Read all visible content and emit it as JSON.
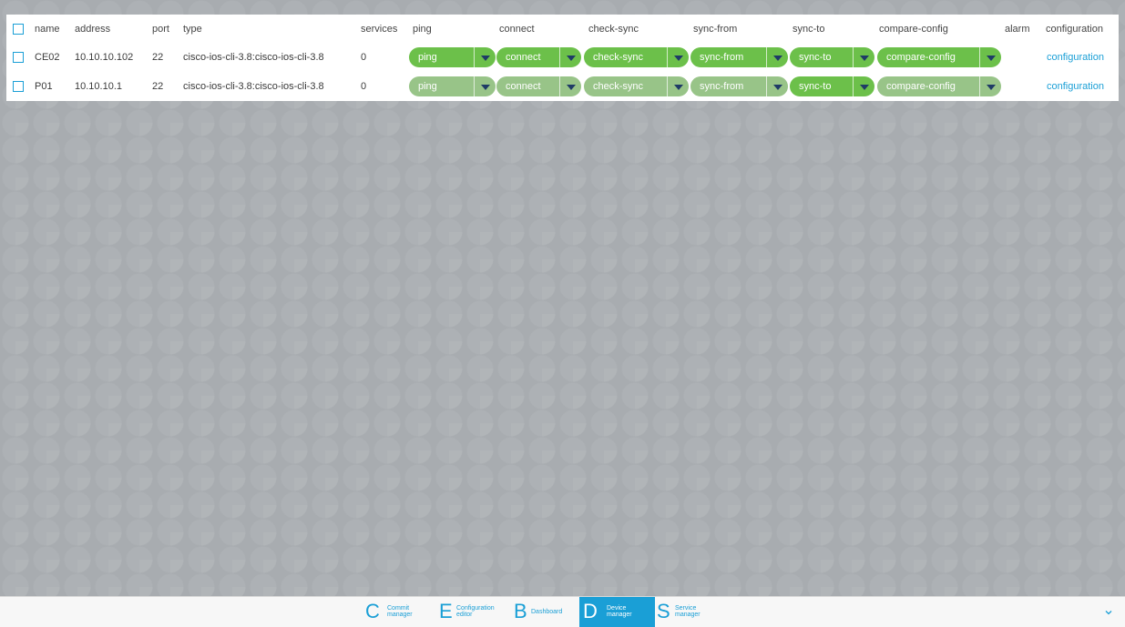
{
  "table": {
    "headers": {
      "name": "name",
      "address": "address",
      "port": "port",
      "type": "type",
      "services": "services",
      "ping": "ping",
      "connect": "connect",
      "check_sync": "check-sync",
      "sync_from": "sync-from",
      "sync_to": "sync-to",
      "compare_config": "compare-config",
      "alarm": "alarm",
      "configuration": "configuration"
    },
    "rows": [
      {
        "name": "CE02",
        "address": "10.10.10.102",
        "port": "22",
        "type": "cisco-ios-cli-3.8:cisco-ios-cli-3.8",
        "services": "0",
        "ping": "ping",
        "connect": "connect",
        "check_sync": "check-sync",
        "sync_from": "sync-from",
        "sync_to": "sync-to",
        "compare_config": "compare-config",
        "configuration": "configuration"
      },
      {
        "name": "P01",
        "address": "10.10.10.1",
        "port": "22",
        "type": "cisco-ios-cli-3.8:cisco-ios-cli-3.8",
        "services": "0",
        "ping": "ping",
        "connect": "connect",
        "check_sync": "check-sync",
        "sync_from": "sync-from",
        "sync_to": "sync-to",
        "compare_config": "compare-config",
        "configuration": "configuration"
      }
    ]
  },
  "footer": {
    "items": [
      {
        "letter": "C",
        "line1": "Commit",
        "line2": "manager"
      },
      {
        "letter": "E",
        "line1": "Configuration",
        "line2": "editor"
      },
      {
        "letter": "B",
        "line1": "Dashboard",
        "line2": ""
      },
      {
        "letter": "D",
        "line1": "Device",
        "line2": "manager"
      },
      {
        "letter": "S",
        "line1": "Service",
        "line2": "manager"
      }
    ],
    "active": "Device manager"
  },
  "colors": {
    "accent": "#1a9fd6",
    "action_green": "#6cc04a",
    "action_green_dim": "#98c488",
    "arrow": "#1f3b66",
    "background": "#a8acb0"
  },
  "icons": {
    "row_checkbox": "checkbox-icon",
    "dropdown": "caret-down-icon",
    "footer_toggle": "chevron-down-icon"
  }
}
